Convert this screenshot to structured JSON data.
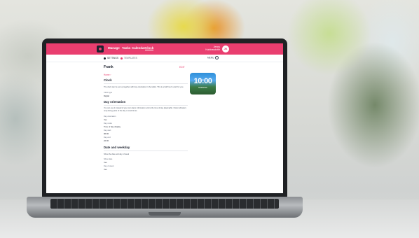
{
  "header": {
    "nav": [
      "Manage",
      "Tasks",
      "Calendar",
      "Clock"
    ],
    "active_nav": "Clock",
    "user_name_line1": "Jenny",
    "user_name_line2": "Katrinasdottir",
    "user_initials": "JK"
  },
  "subbar": {
    "tabs": [
      "SETTINGS",
      "TEMPLATES"
    ],
    "right_label": "MENU"
  },
  "page": {
    "title": "Frank",
    "edit_label": "EDIT",
    "home_link": "Home ›"
  },
  "clock_section": {
    "title": "Clock",
    "description": "The clock can be set up together with day orientation in the tablet. This is a half hour's work for you.",
    "type_label": "Clock type",
    "type_value": "Digital"
  },
  "preview": {
    "time": "10:00",
    "sub": "MORNING"
  },
  "day_section": {
    "title": "Day orientation",
    "description": "You can use it instead of your own day's information and is the time of day (day/night). Clock indicators only during parts of the day or at all times.",
    "fields": [
      {
        "label": "Day orientation",
        "value": "Yes"
      },
      {
        "label": "Day mode",
        "value": "Time of day display"
      },
      {
        "label": "Day start",
        "value": "06:00"
      },
      {
        "label": "Day end",
        "value": "22:00"
      }
    ]
  },
  "date_section": {
    "title": "Date and weekday",
    "description": "Show the date and day of week",
    "fields": [
      {
        "label": "Show date",
        "value": "Yes"
      },
      {
        "label": "Day of week",
        "value": "Yes"
      }
    ]
  },
  "colors": {
    "accent": "#e93e6f",
    "dark": "#1e2330"
  }
}
